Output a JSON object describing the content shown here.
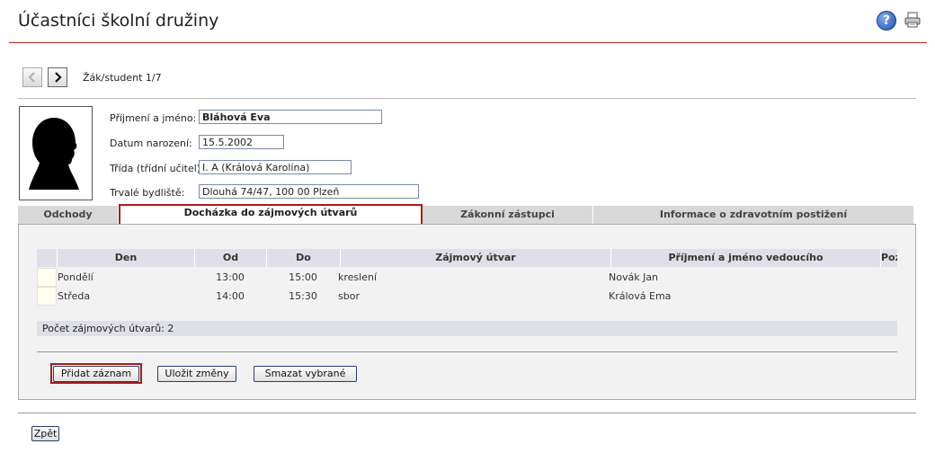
{
  "header": {
    "title": "Účastníci školní družiny"
  },
  "navigation": {
    "counter": "Žák/student 1/7"
  },
  "student": {
    "name_label": "Příjmení a jméno:",
    "name_value": "Bláhová Eva",
    "birth_label": "Datum narození:",
    "birth_value": "15.5.2002",
    "class_label": "Třída (třídní učitel):",
    "class_value": "I. A (Králová Karolína)",
    "address_label": "Trvalé bydliště:",
    "address_value": "Dlouhá 74/47, 100 00 Plzeň"
  },
  "tabs": [
    {
      "label": "Odchody"
    },
    {
      "label": "Docházka do zájmových útvarů",
      "active": true
    },
    {
      "label": "Zákonní zástupci"
    },
    {
      "label": "Informace o zdravotním postižení"
    }
  ],
  "table": {
    "headers": [
      "Den",
      "Od",
      "Do",
      "Zájmový útvar",
      "Příjmení a jméno vedoucího",
      "Poz"
    ],
    "rows": [
      [
        "Pondělí",
        "13:00",
        "15:00",
        "kreslení",
        "Novák Jan"
      ],
      [
        "Středa",
        "14:00",
        "15:30",
        "sbor",
        "Králová Ema"
      ]
    ],
    "count": "Počet zájmových útvarů: 2"
  },
  "buttons": {
    "add": "Přidat záznam",
    "save": "Uložit změny",
    "delete": "Smazat vybrané",
    "back": "Zpět"
  },
  "colors": {
    "accent": "#b22222",
    "header_bg": "#dfe0e7"
  }
}
